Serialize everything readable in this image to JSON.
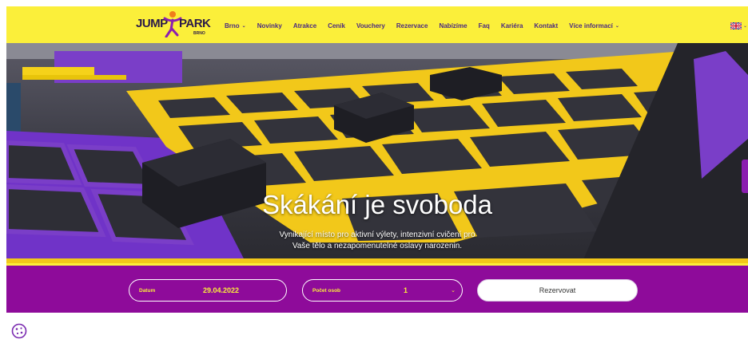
{
  "logo": {
    "jump": "JUMP",
    "park": "PARK",
    "sub": "BRNO"
  },
  "nav": {
    "items": [
      {
        "label": "Brno",
        "dropdown": true
      },
      {
        "label": "Novinky",
        "dropdown": false
      },
      {
        "label": "Atrakce",
        "dropdown": false
      },
      {
        "label": "Ceník",
        "dropdown": false
      },
      {
        "label": "Vouchery",
        "dropdown": false
      },
      {
        "label": "Rezervace",
        "dropdown": false
      },
      {
        "label": "Nabízíme",
        "dropdown": false
      },
      {
        "label": "Faq",
        "dropdown": false
      },
      {
        "label": "Kariéra",
        "dropdown": false
      },
      {
        "label": "Kontakt",
        "dropdown": false
      },
      {
        "label": "Více informací",
        "dropdown": true
      }
    ],
    "language_icon": "uk-flag-icon",
    "caret": "⌄"
  },
  "hero": {
    "title": "Skákání je svoboda",
    "subtitle_line1": "Vynikající místo pro aktivní výlety, intenzivní cvičení pro",
    "subtitle_line2": "Vaše tělo a nezapomenutelné oslavy narozenin."
  },
  "booking": {
    "date_label": "Datum",
    "date_value": "29.04.2022",
    "persons_label": "Počet osob",
    "persons_value": "1",
    "reserve_label": "Rezervovat"
  },
  "colors": {
    "header_yellow": "#fbef3a",
    "brand_purple": "#8e0b9a",
    "nav_text": "#4a2a80",
    "accent_yellow": "#fbef3a"
  },
  "cookie": {
    "icon": "cookie-settings-icon"
  }
}
